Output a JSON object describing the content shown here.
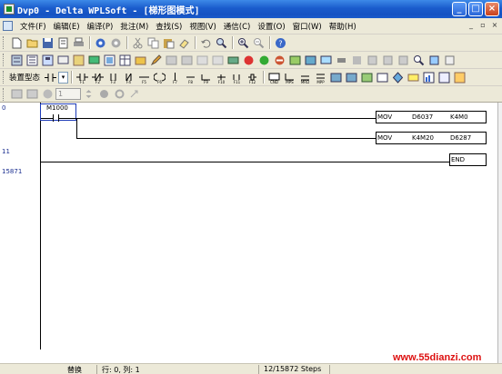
{
  "window": {
    "title": "Dvp0 - Delta WPLSoft - [梯形图模式]",
    "controls": [
      "_",
      "□",
      "×"
    ]
  },
  "menubar": {
    "items": [
      "文件(F)",
      "编辑(E)",
      "编译(P)",
      "批注(M)",
      "查找(S)",
      "视图(V)",
      "通信(C)",
      "设置(O)",
      "窗口(W)",
      "帮助(H)"
    ]
  },
  "toolbar3": {
    "label": "装置型态",
    "type_value": "",
    "f_keys": [
      "F1",
      "F2",
      "F3",
      "F4",
      "F5",
      "F6",
      "F7",
      "F8",
      "F9",
      "F10",
      "F11",
      "F12"
    ]
  },
  "toolbar4": {
    "step_value": "1"
  },
  "ladder": {
    "row_numbers": [
      "0",
      "11",
      "15871"
    ],
    "contact_label": "M1000",
    "instructions": [
      {
        "op": "MOV",
        "src": "D6037",
        "dst": "K4M0"
      },
      {
        "op": "MOV",
        "src": "K4M20",
        "dst": "D6287"
      }
    ],
    "end_label": "END"
  },
  "status": {
    "mode": "替换",
    "position": "行: 0, 列: 1",
    "steps": "12/15872 Steps"
  },
  "watermark": "www.55dianzi.com",
  "colors": {
    "titlebar": "#1a5ccc",
    "row_number": "#1b2f90",
    "watermark": "#dd1111"
  }
}
